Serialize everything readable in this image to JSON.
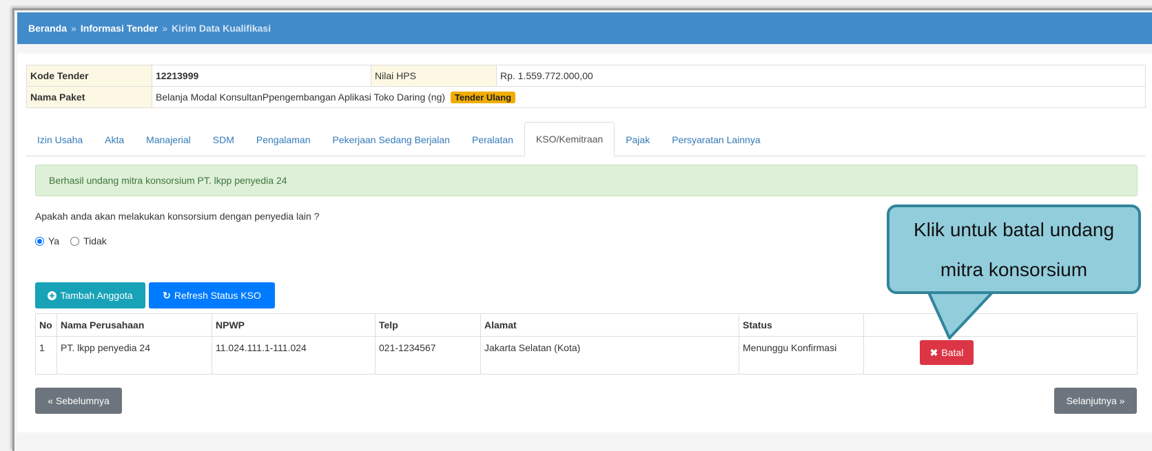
{
  "breadcrumb": {
    "home": "Beranda",
    "separator": "»",
    "info": "Informasi Tender",
    "current": "Kirim Data Kualifikasi"
  },
  "tender_info": {
    "kode_label": "Kode Tender",
    "kode_value": "12213999",
    "hps_label": "Nilai HPS",
    "hps_value": "Rp. 1.559.772.000,00",
    "paket_label": "Nama Paket",
    "paket_value": "Belanja Modal KonsultanPpengembangan Aplikasi Toko Daring (ng)",
    "badge": "Tender Ulang"
  },
  "tabs": [
    {
      "label": "Izin Usaha"
    },
    {
      "label": "Akta"
    },
    {
      "label": "Manajerial"
    },
    {
      "label": "SDM"
    },
    {
      "label": "Pengalaman"
    },
    {
      "label": "Pekerjaan Sedang Berjalan"
    },
    {
      "label": "Peralatan"
    },
    {
      "label": "KSO/Kemitraan",
      "active": true
    },
    {
      "label": "Pajak"
    },
    {
      "label": "Persyaratan Lainnya"
    }
  ],
  "alert": "Berhasil undang mitra konsorsium PT. lkpp penyedia 24",
  "question": "Apakah anda akan melakukan konsorsium dengan penyedia lain ?",
  "radio": {
    "yes": "Ya",
    "no": "Tidak",
    "selected": "Ya"
  },
  "buttons": {
    "tambah": "Tambah Anggota",
    "refresh": "Refresh Status KSO",
    "batal": "Batal",
    "prev": "« Sebelumnya",
    "next": "Selanjutnya »"
  },
  "members_table": {
    "headers": [
      "No",
      "Nama Perusahaan",
      "NPWP",
      "Telp",
      "Alamat",
      "Status",
      ""
    ],
    "rows": [
      [
        "1",
        "PT. lkpp penyedia 24",
        "11.024.111.1-111.024",
        "021-1234567",
        "Jakarta Selatan (Kota)",
        "Menunggu Konfirmasi"
      ]
    ]
  },
  "callout": {
    "line1": "Klik untuk batal undang",
    "line2": "mitra konsorsium"
  },
  "colors": {
    "header_blue": "#428bca",
    "tab_link": "#337ab7",
    "alert_bg": "#dff0d8",
    "badge": "#f0ad00",
    "teal": "#17a2b8",
    "primary": "#007bff",
    "danger": "#dc3545",
    "secondary": "#6c757d",
    "callout_fill": "#92cddc",
    "callout_border": "#31849b"
  },
  "icons": {
    "tambah": "plus-circle-icon",
    "refresh": "refresh-icon",
    "batal": "close-icon"
  }
}
